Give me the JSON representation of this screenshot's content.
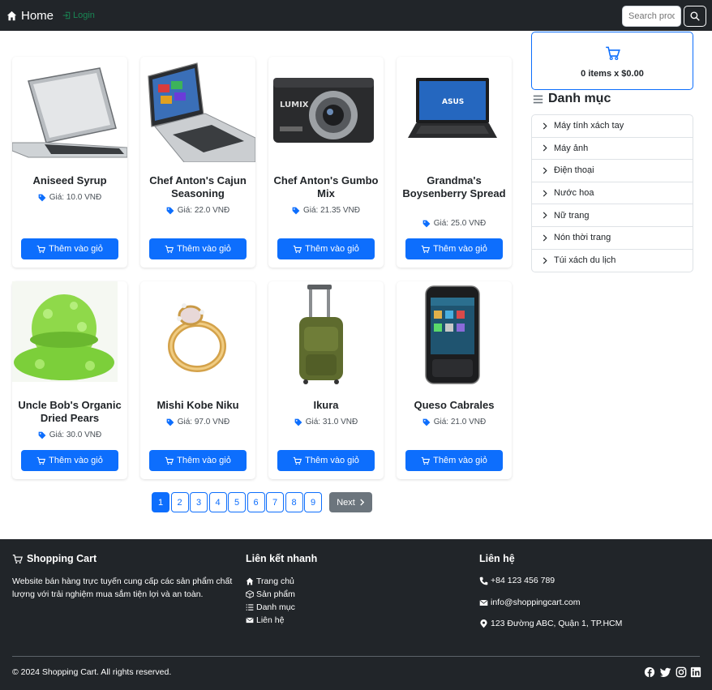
{
  "navbar": {
    "brand": "Home",
    "login": "Login",
    "search_placeholder": "Search products"
  },
  "cart": {
    "summary": "0 items x $0.00"
  },
  "categories": {
    "title": "Danh mục",
    "items": [
      "Máy tính xách tay",
      "Máy ảnh",
      "Điện thoại",
      "Nước hoa",
      "Nữ trang",
      "Nón thời trang",
      "Túi xách du lịch"
    ]
  },
  "products": [
    {
      "name": "Aniseed Syrup",
      "price": "Giá: 10.0 VNĐ",
      "button": "Thêm vào giỏ",
      "image": "laptop-silver"
    },
    {
      "name": "Chef Anton's Cajun Seasoning",
      "price": "Giá: 22.0 VNĐ",
      "button": "Thêm vào giỏ",
      "image": "laptop-convertible"
    },
    {
      "name": "Chef Anton's Gumbo Mix",
      "price": "Giá: 21.35 VNĐ",
      "button": "Thêm vào giỏ",
      "image": "camera"
    },
    {
      "name": "Grandma's Boysenberry Spread",
      "price": "Giá: 25.0 VNĐ",
      "button": "Thêm vào giỏ",
      "image": "laptop-black"
    },
    {
      "name": "Uncle Bob's Organic Dried Pears",
      "price": "Giá: 30.0 VNĐ",
      "button": "Thêm vào giỏ",
      "image": "green-hat"
    },
    {
      "name": "Mishi Kobe Niku",
      "price": "Giá: 97.0 VNĐ",
      "button": "Thêm vào giỏ",
      "image": "ring"
    },
    {
      "name": "Ikura",
      "price": "Giá: 31.0 VNĐ",
      "button": "Thêm vào giỏ",
      "image": "luggage"
    },
    {
      "name": "Queso Cabrales",
      "price": "Giá: 21.0 VNĐ",
      "button": "Thêm vào giỏ",
      "image": "smartphone"
    }
  ],
  "pagination": {
    "pages": [
      "1",
      "2",
      "3",
      "4",
      "5",
      "6",
      "7",
      "8",
      "9"
    ],
    "active": "1",
    "next": "Next"
  },
  "footer": {
    "brand": "Shopping Cart",
    "description": "Website bán hàng trực tuyến cung cấp các sản phẩm chất lượng với trải nghiệm mua sắm tiện lợi và an toàn.",
    "links_title": "Liên kết nhanh",
    "links": [
      "Trang chủ",
      "Sản phẩm",
      "Danh mục",
      "Liên hệ"
    ],
    "contact_title": "Liên hệ",
    "phone": "+84 123 456 789",
    "email": "info@shoppingcart.com",
    "address": "123 Đường ABC, Quận 1, TP.HCM",
    "copyright": "© 2024 Shopping Cart. All rights reserved."
  },
  "colors": {
    "primary": "#0d6efd",
    "dark": "#212529",
    "success": "#198754",
    "secondary": "#6c757d"
  }
}
